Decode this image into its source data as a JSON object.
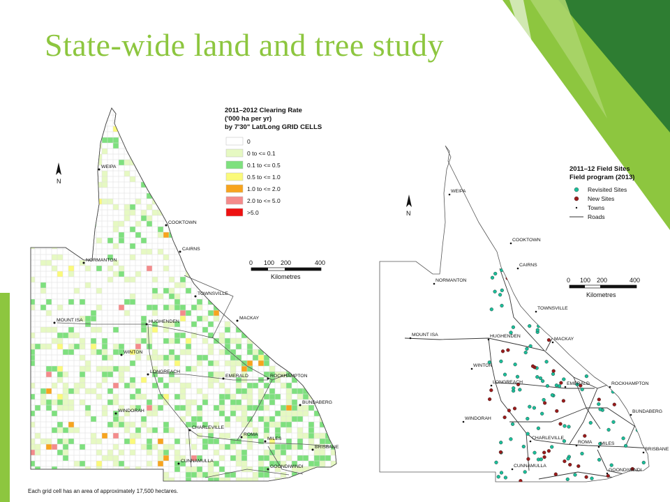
{
  "slide": {
    "title": "State-wide land and tree study",
    "accent_color": "#8dc63f",
    "accent_dark": "#2e7d32"
  },
  "left_map": {
    "legend_title_lines": [
      "2011–2012 Clearing Rate",
      "('000 ha per yr)",
      "by 7'30\" Lat/Long GRID CELLS"
    ],
    "legend_items": [
      {
        "label": "0",
        "color": "#ffffff"
      },
      {
        "label": "0 to <= 0.1",
        "color": "#e6f9c2"
      },
      {
        "label": "0.1 to <= 0.5",
        "color": "#7ee07e"
      },
      {
        "label": "0.5 to <= 1.0",
        "color": "#fbfa7a"
      },
      {
        "label": "1.0 to <= 2.0",
        "color": "#f7a41e"
      },
      {
        "label": "2.0 to <= 5.0",
        "color": "#f48b8b"
      },
      {
        "label": ">5.0",
        "color": "#ee1111"
      }
    ],
    "north_label": "N",
    "scale_ticks": [
      "0",
      "100",
      "200",
      "400"
    ],
    "scale_unit": "Kilometres",
    "towns": [
      "WEIPA",
      "COOKTOWN",
      "CAIRNS",
      "NORMANTON",
      "TOWNSVILLE",
      "MOUNT ISA",
      "HUGHENDEN",
      "MACKAY",
      "WINTON",
      "LONGREACH",
      "EMERALD",
      "ROCKHAMPTON",
      "BUNDABERG",
      "WINDORAH",
      "CHARLEVILLE",
      "ROMA",
      "MILES",
      "BRISBANE",
      "CUNNAMULLA",
      "GOONDIWINDI"
    ],
    "caption": "Each grid cell has an area of approximately 17,500 hectares."
  },
  "right_map": {
    "legend_title_lines": [
      "2011–12 Field Sites",
      "Field program (2013)"
    ],
    "legend_items": [
      {
        "label": "Revisited Sites",
        "symbol": "dot",
        "color": "#1bbf9a"
      },
      {
        "label": "New Sites",
        "symbol": "dot",
        "color": "#9b1b1b"
      },
      {
        "label": "Towns",
        "symbol": "small-dot",
        "color": "#111111"
      },
      {
        "label": "Roads",
        "symbol": "line",
        "color": "#333333"
      }
    ],
    "north_label": "N",
    "scale_ticks": [
      "0",
      "100",
      "200",
      "400"
    ],
    "scale_unit": "Kilometres",
    "towns": [
      "WEIPA",
      "COOKTOWN",
      "CAIRNS",
      "NORMANTON",
      "TOWNSVILLE",
      "MACKAY",
      "MOUNT ISA",
      "HUGHENDEN",
      "WINTON",
      "LONGREACH",
      "EMERALD",
      "ROCKHAMPTON",
      "BUNDABERG",
      "WINDORAH",
      "CHARLEVILLE",
      "ROMA",
      "MILES",
      "BRISBANE",
      "CUNNAMULLA",
      "GOONDIWINDI"
    ]
  }
}
